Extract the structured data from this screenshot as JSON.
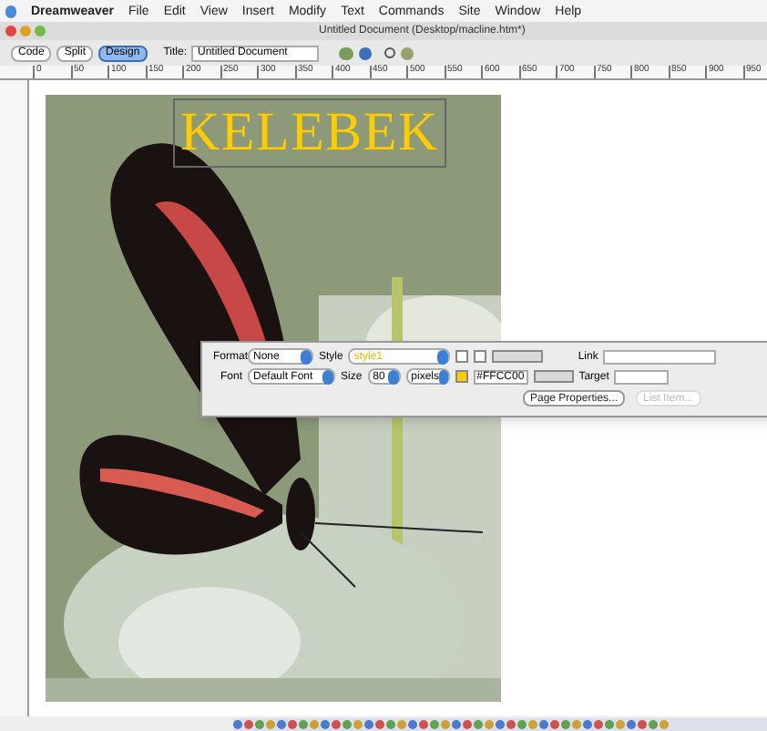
{
  "menu_bar": {
    "items": [
      "Dreamweaver",
      "File",
      "Edit",
      "View",
      "Insert",
      "Modify",
      "Text",
      "Commands",
      "Site",
      "Window",
      "Help"
    ]
  },
  "window": {
    "title": "Untitled Document (Desktop/macline.htm*)"
  },
  "toolbar": {
    "views": [
      {
        "label": "Code",
        "selected": false
      },
      {
        "label": "Split",
        "selected": false
      },
      {
        "label": "Design",
        "selected": true
      }
    ],
    "title_label": "Title:",
    "title_value": "Untitled Document"
  },
  "ruler": {
    "labels": [
      "0",
      "50",
      "100",
      "150",
      "200",
      "250",
      "300",
      "350",
      "400",
      "450",
      "500",
      "550",
      "600",
      "650",
      "700",
      "750",
      "800",
      "850",
      "900",
      "950"
    ]
  },
  "document": {
    "heading": "KELEBEK"
  },
  "properties": {
    "format_label": "Format",
    "format_value": "None",
    "style_label": "Style",
    "style_value": "style1",
    "font_label": "Font",
    "font_value": "Default Font",
    "size_label": "Size",
    "size_value": "80",
    "unit_value": "pixels",
    "color_value": "#FFCC00",
    "link_label": "Link",
    "target_label": "Target",
    "buttons": [
      {
        "label": "Page Properties...",
        "disabled": false
      },
      {
        "label": "List Item...",
        "disabled": true
      }
    ]
  }
}
